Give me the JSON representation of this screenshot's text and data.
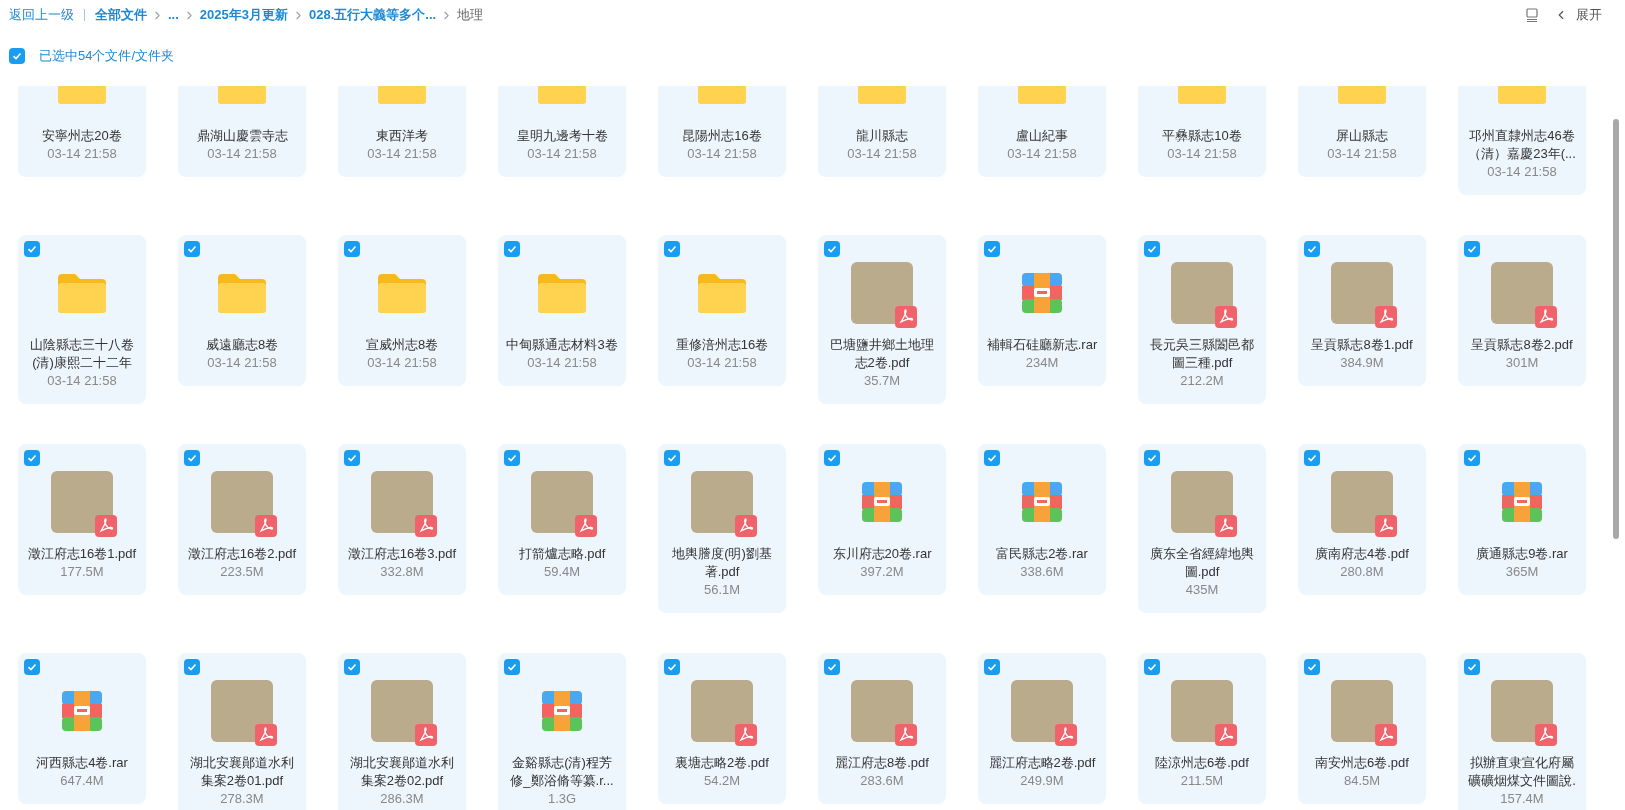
{
  "breadcrumb": {
    "back": "返回上一级",
    "items": [
      {
        "label": "全部文件",
        "current": false
      },
      {
        "label": "...",
        "current": false
      },
      {
        "label": "2025年3月更新",
        "current": false
      },
      {
        "label": "028.五行大義等多个...",
        "current": false
      },
      {
        "label": "地理",
        "current": true
      }
    ]
  },
  "toolbar": {
    "expand": "展开"
  },
  "selection": {
    "checked": true,
    "label": "已选中54个文件/文件夹"
  },
  "files": [
    {
      "kind": "folder",
      "name": "安寧州志20卷",
      "meta": "03-14 21:58"
    },
    {
      "kind": "folder",
      "name": "鼎湖山慶雲寺志",
      "meta": "03-14 21:58"
    },
    {
      "kind": "folder",
      "name": "東西洋考",
      "meta": "03-14 21:58"
    },
    {
      "kind": "folder",
      "name": "皇明九邊考十卷",
      "meta": "03-14 21:58"
    },
    {
      "kind": "folder",
      "name": "昆陽州志16卷",
      "meta": "03-14 21:58"
    },
    {
      "kind": "folder",
      "name": "龍川縣志",
      "meta": "03-14 21:58"
    },
    {
      "kind": "folder",
      "name": "盧山紀事",
      "meta": "03-14 21:58"
    },
    {
      "kind": "folder",
      "name": "平彝縣志10卷",
      "meta": "03-14 21:58"
    },
    {
      "kind": "folder",
      "name": "屏山縣志",
      "meta": "03-14 21:58"
    },
    {
      "kind": "folder",
      "name": "邛州直隸州志46卷（清）嘉慶23年(...",
      "meta": "03-14 21:58"
    },
    {
      "kind": "folder",
      "name": "山陰縣志三十八卷(清)康熙二十二年",
      "meta": "03-14 21:58",
      "checked": true
    },
    {
      "kind": "folder",
      "name": "威遠廳志8卷",
      "meta": "03-14 21:58",
      "checked": true
    },
    {
      "kind": "folder",
      "name": "宣威州志8卷",
      "meta": "03-14 21:58",
      "checked": true
    },
    {
      "kind": "folder",
      "name": "中甸縣通志材料3卷",
      "meta": "03-14 21:58",
      "checked": true
    },
    {
      "kind": "folder",
      "name": "重修涪州志16卷",
      "meta": "03-14 21:58",
      "checked": true
    },
    {
      "kind": "pdf",
      "name": "巴塘鹽井鄉土地理志2卷.pdf",
      "meta": "35.7M",
      "checked": true
    },
    {
      "kind": "rar",
      "name": "補輯石硅廳新志.rar",
      "meta": "234M",
      "checked": true
    },
    {
      "kind": "pdf",
      "name": "長元吳三縣闔邑都圖三種.pdf",
      "meta": "212.2M",
      "checked": true
    },
    {
      "kind": "pdf",
      "name": "呈貢縣志8卷1.pdf",
      "meta": "384.9M",
      "checked": true
    },
    {
      "kind": "pdf",
      "name": "呈貢縣志8卷2.pdf",
      "meta": "301M",
      "checked": true
    },
    {
      "kind": "pdf",
      "name": "澂江府志16卷1.pdf",
      "meta": "177.5M",
      "checked": true
    },
    {
      "kind": "pdf",
      "name": "澂江府志16卷2.pdf",
      "meta": "223.5M",
      "checked": true
    },
    {
      "kind": "pdf",
      "name": "澂江府志16卷3.pdf",
      "meta": "332.8M",
      "checked": true
    },
    {
      "kind": "pdf",
      "name": "打箭爐志略.pdf",
      "meta": "59.4M",
      "checked": true
    },
    {
      "kind": "pdf",
      "name": "地輿謄度(明)劉基著.pdf",
      "meta": "56.1M",
      "checked": true
    },
    {
      "kind": "rar",
      "name": "东川府志20卷.rar",
      "meta": "397.2M",
      "checked": true
    },
    {
      "kind": "rar",
      "name": "富民縣志2卷.rar",
      "meta": "338.6M",
      "checked": true
    },
    {
      "kind": "pdf",
      "name": "廣东全省經緯地輿圖.pdf",
      "meta": "435M",
      "checked": true
    },
    {
      "kind": "pdf",
      "name": "廣南府志4卷.pdf",
      "meta": "280.8M",
      "checked": true
    },
    {
      "kind": "rar",
      "name": "廣通縣志9卷.rar",
      "meta": "365M",
      "checked": true
    },
    {
      "kind": "rar",
      "name": "河西縣志4卷.rar",
      "meta": "647.4M",
      "checked": true
    },
    {
      "kind": "pdf",
      "name": "湖北安襄鄖道水利集案2卷01.pdf",
      "meta": "278.3M",
      "checked": true
    },
    {
      "kind": "pdf",
      "name": "湖北安襄鄖道水利集案2卷02.pdf",
      "meta": "286.3M",
      "checked": true
    },
    {
      "kind": "rar",
      "name": "金谿縣志(清)程芳修_鄭浴脩等纂.r...",
      "meta": "1.3G",
      "checked": true
    },
    {
      "kind": "pdf",
      "name": "裏塘志略2卷.pdf",
      "meta": "54.2M",
      "checked": true
    },
    {
      "kind": "pdf",
      "name": "麗江府志8卷.pdf",
      "meta": "283.6M",
      "checked": true
    },
    {
      "kind": "pdf",
      "name": "麗江府志略2卷.pdf",
      "meta": "249.9M",
      "checked": true
    },
    {
      "kind": "pdf",
      "name": "陸涼州志6卷.pdf",
      "meta": "211.5M",
      "checked": true
    },
    {
      "kind": "pdf",
      "name": "南安州志6卷.pdf",
      "meta": "84.5M",
      "checked": true
    },
    {
      "kind": "pdf",
      "name": "拟辦直隶宣化府屬礦礦烟煤文件圖說.",
      "meta": "157.4M",
      "checked": true
    }
  ]
}
